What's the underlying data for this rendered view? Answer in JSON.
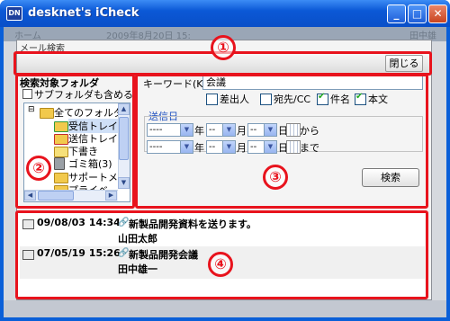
{
  "window": {
    "title": "desknet's iCheck",
    "app_icon": "DN",
    "controls": {
      "minimize": "_",
      "maximize": "□",
      "close": "✕"
    }
  },
  "background": {
    "home": "ホーム",
    "date": "2009年8月20日 15:",
    "user": "田中雄"
  },
  "dialog": {
    "caption": "メール検索",
    "close_label": "閉じる"
  },
  "folders": {
    "title": "検索対象フォルダ",
    "subfolder_label": "サブフォルダも含める",
    "items": [
      {
        "label": "全てのフォルダ",
        "icon": "folder-icon"
      },
      {
        "label": "受信トレイ(",
        "icon": "inbox-icon"
      },
      {
        "label": "送信トレイ",
        "icon": "outbox-icon"
      },
      {
        "label": "下書き",
        "icon": "draft-icon"
      },
      {
        "label": "ゴミ箱(3)",
        "icon": "trash-icon"
      },
      {
        "label": "サポートメー",
        "icon": "folder-icon"
      },
      {
        "label": "プライベ",
        "icon": "folder-icon"
      }
    ]
  },
  "search": {
    "keyword_label": "キーワード(K)",
    "keyword_value": "会議",
    "fields": [
      {
        "label": "差出人",
        "checked": false
      },
      {
        "label": "宛先/CC",
        "checked": false
      },
      {
        "label": "件名",
        "checked": true
      },
      {
        "label": "本文",
        "checked": true
      }
    ],
    "sent_date_label": "送信日",
    "year_placeholder": "----",
    "md_placeholder": "--",
    "unit_year": "年",
    "unit_month": "月",
    "unit_day": "日",
    "from_label": "から",
    "to_label": "まで",
    "search_button": "検索"
  },
  "results": [
    {
      "date": "09/08/03 14:34",
      "subject": "新製品開発資料を送ります。",
      "from": "山田太郎"
    },
    {
      "date": "07/05/19 15:26",
      "subject": "新製品開発会議",
      "from": "田中雄一"
    }
  ],
  "callouts": [
    "①",
    "②",
    "③",
    "④"
  ],
  "colors": {
    "callout": "#e8131d",
    "titlebar": "#0a5fd8",
    "date_label": "#1d4fbf"
  }
}
